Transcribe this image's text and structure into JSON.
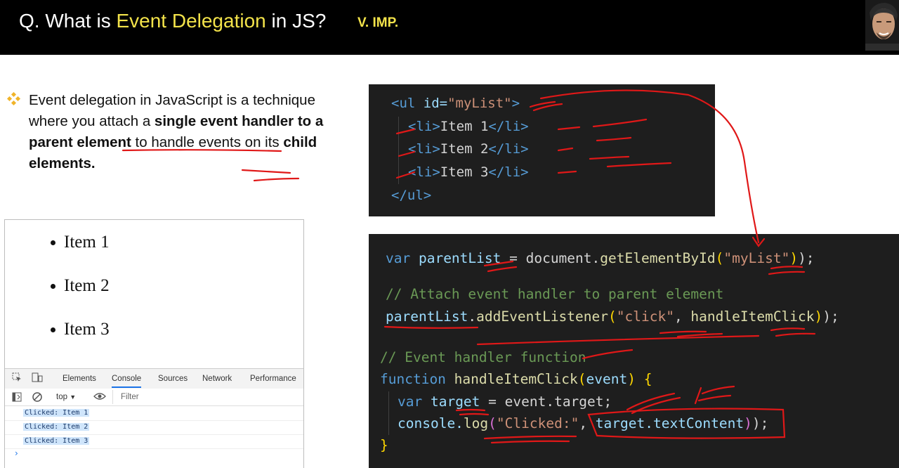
{
  "header": {
    "question_prefix": "Q. What is ",
    "question_highlight": "Event Delegation",
    "question_suffix": " in JS?",
    "importance": "V. IMP."
  },
  "bullet": {
    "p1": "Event delegation in JavaScript is a technique where you attach a ",
    "b1": "single event handler to a parent element",
    "p2": " to handle events on its ",
    "b2": "child elements."
  },
  "browser": {
    "list_items": [
      "Item 1",
      "Item 2",
      "Item 3"
    ],
    "devtools_tabs": [
      "Elements",
      "Console",
      "Sources",
      "Network",
      "Performance"
    ],
    "active_tab": "Console",
    "context": "top",
    "filter_placeholder": "Filter",
    "console_logs": [
      "Clicked: Item 1",
      "Clicked: Item 2",
      "Clicked: Item 3"
    ],
    "prompt": "›"
  },
  "html_code": {
    "ul_open_tag": "<ul",
    "ul_attr": " id=",
    "ul_id": "\"myList\"",
    "ul_close": ">",
    "items": [
      "Item 1",
      "Item 2",
      "Item 3"
    ],
    "li_open": "<li>",
    "li_close": "</li>",
    "ul_end": "</ul>"
  },
  "js_code": {
    "l1_kw": "var",
    "l1_var": " parentList",
    "l1_mid": " = document.",
    "l1_fn": "getElementById",
    "l1_arg": "\"myList\"",
    "l1_end": ");",
    "l2_comment": "// Attach event handler to parent element",
    "l3_var": "parentList",
    "l3_dot": ".",
    "l3_fn": "addEventListener",
    "l3_arg1": "\"click\"",
    "l3_sep": ", ",
    "l3_arg2": "handleItemClick",
    "l3_end": ");",
    "l4_comment": "// Event handler function",
    "l5_kw": "function",
    "l5_fn": " handleItemClick",
    "l5_param": "event",
    "l6_kw": "var",
    "l6_var": " target",
    "l6_rest": " = event.target;",
    "l7_obj": "console.",
    "l7_fn": "log",
    "l7_arg1": "\"Clicked:\"",
    "l7_sep": ", ",
    "l7_arg2": "target.textContent",
    "l7_end": ");",
    "l8": "}"
  },
  "colors": {
    "header_bg": "#000000",
    "highlight": "#f3e34a",
    "code_bg": "#1e1e1e",
    "annotation_ink": "#e01818"
  }
}
